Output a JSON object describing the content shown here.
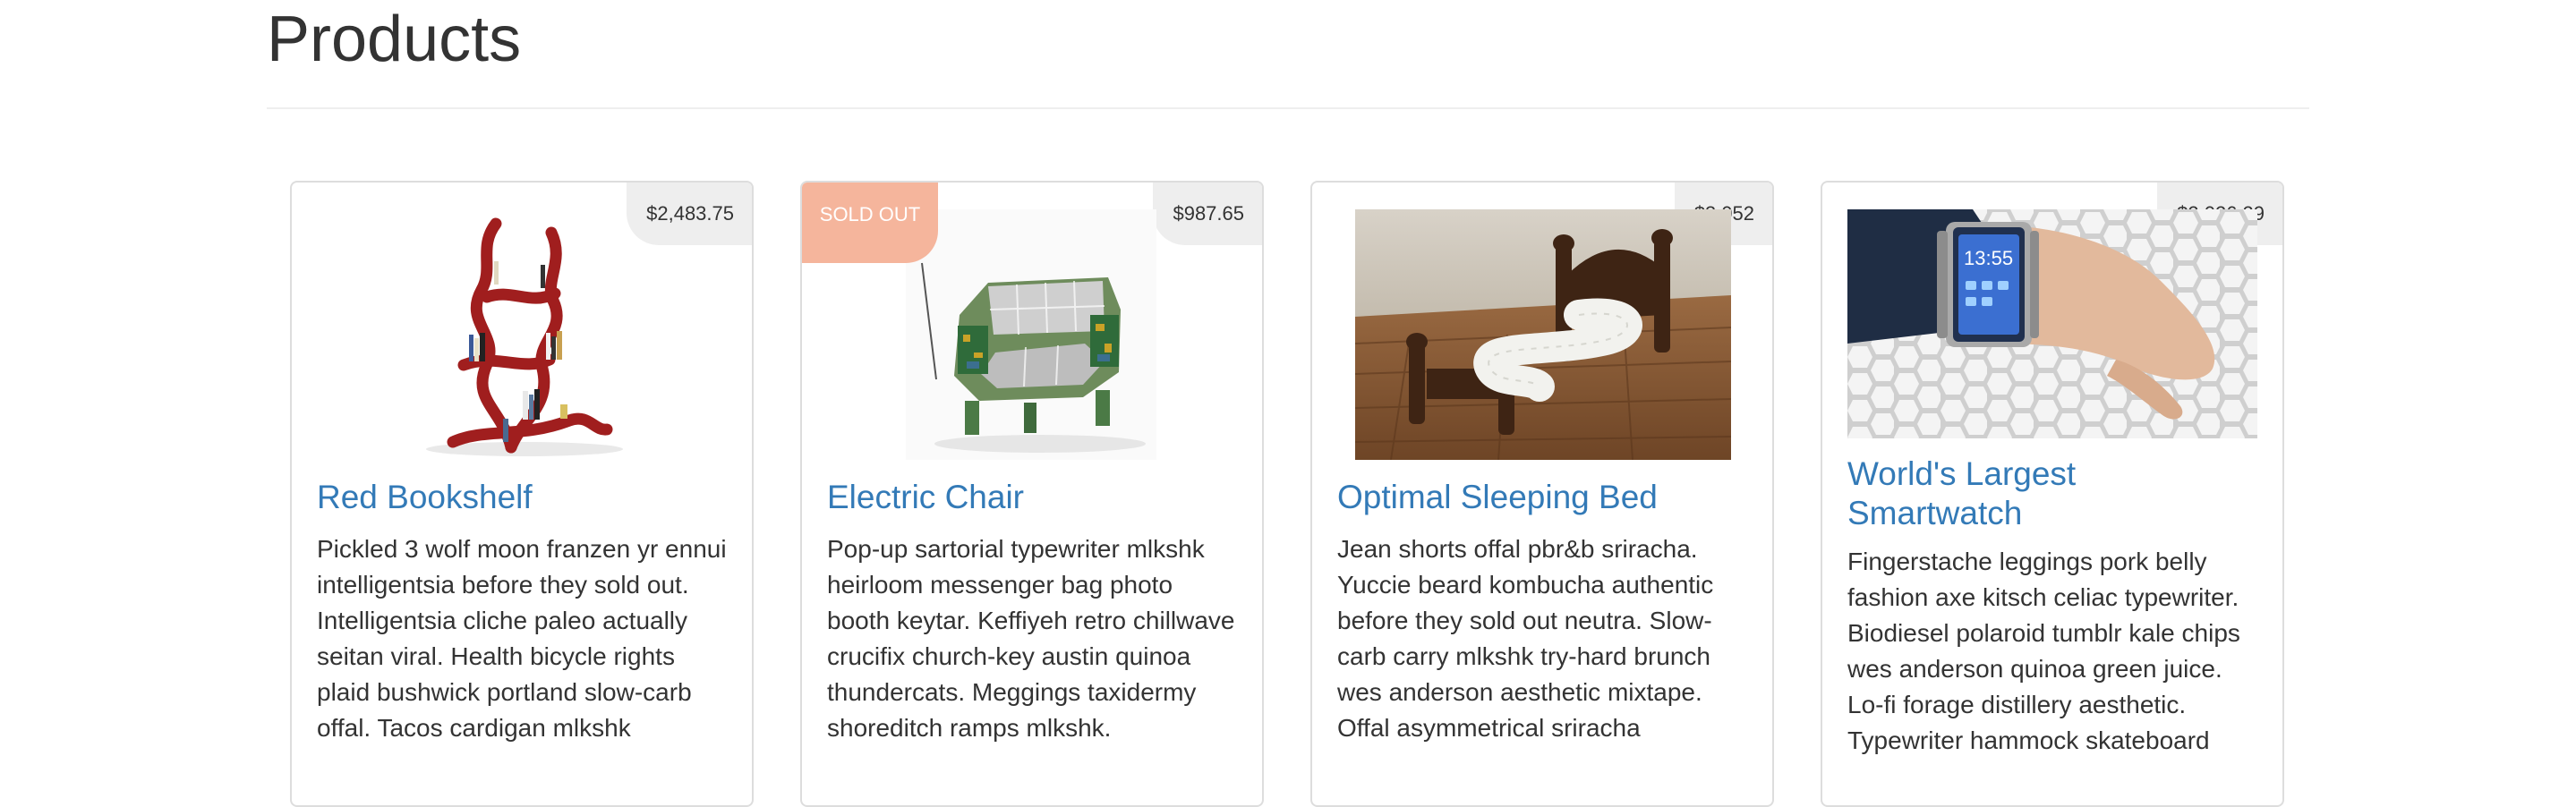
{
  "page": {
    "title": "Products"
  },
  "products": [
    {
      "name": "Red Bookshelf",
      "price": "$2,483.75",
      "sold_out": false,
      "image": "red-tree-bookshelf-icon",
      "description": "Pickled 3 wolf moon franzen yr ennui intelligentsia before they sold out. Intelligentsia cliche paleo actually seitan viral. Health bicycle rights plaid bushwick portland slow-carb offal. Tacos cardigan mlkshk"
    },
    {
      "name": "Electric Chair",
      "price": "$987.65",
      "sold_out": true,
      "sold_label": "SOLD OUT",
      "image": "circuit-board-armchair-icon",
      "description": "Pop-up sartorial typewriter mlkshk heirloom messenger bag photo booth keytar. Keffiyeh retro chillwave crucifix church-key austin quinoa thundercats. Meggings taxidermy shoreditch ramps mlkshk."
    },
    {
      "name": "Optimal Sleeping Bed",
      "price": "$3,052",
      "sold_out": false,
      "image": "zigzag-bed-icon",
      "description": "Jean shorts offal pbr&b sriracha. Yuccie beard kombucha authentic before they sold out neutra. Slow-carb carry mlkshk try-hard brunch wes anderson aesthetic mixtape. Offal asymmetrical sriracha"
    },
    {
      "name": "World's Largest Smartwatch",
      "price": "$2,026.29",
      "sold_out": false,
      "image": "wrist-smartwatch-icon",
      "watch_time": "13:55",
      "description": "Fingerstache leggings pork belly fashion axe kitsch celiac typewriter. Biodiesel polaroid tumblr kale chips wes anderson quinoa green juice. Lo-fi forage distillery aesthetic. Typewriter hammock skateboard"
    }
  ],
  "colors": {
    "link": "#337ab7",
    "text": "#333333",
    "price_bg": "#eeeeee",
    "sold_out_bg": "#f5b59c",
    "border": "#dddddd"
  }
}
